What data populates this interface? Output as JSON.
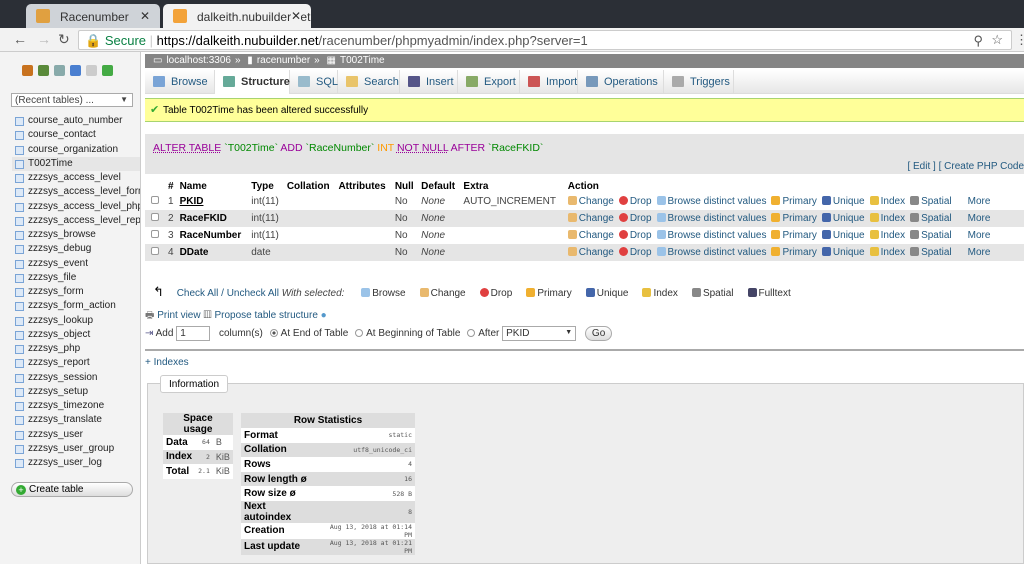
{
  "browser": {
    "tabs": [
      {
        "title": "Racenumber",
        "active": false
      },
      {
        "title": "dalkeith.nubuilder.net / lo",
        "active": true
      }
    ],
    "secure_label": "Secure",
    "url_host": "https://dalkeith.nubuilder.net",
    "url_path": "/racenumber/phpmyadmin/index.php?server=1"
  },
  "sidebar": {
    "nav_icons": [
      "home-icon",
      "logout-icon",
      "sql-query-icon",
      "docs-icon",
      "settings-icon",
      "reload-icon"
    ],
    "recent_tables": "(Recent tables) ...",
    "tables": [
      "course_auto_number",
      "course_contact",
      "course_organization",
      "T002Time",
      "zzzsys_access_level",
      "zzzsys_access_level_form",
      "zzzsys_access_level_php",
      "zzzsys_access_level_report",
      "zzzsys_browse",
      "zzzsys_debug",
      "zzzsys_event",
      "zzzsys_file",
      "zzzsys_form",
      "zzzsys_form_action",
      "zzzsys_lookup",
      "zzzsys_object",
      "zzzsys_php",
      "zzzsys_report",
      "zzzsys_session",
      "zzzsys_setup",
      "zzzsys_timezone",
      "zzzsys_translate",
      "zzzsys_user",
      "zzzsys_user_group",
      "zzzsys_user_log"
    ],
    "selected_table": "T002Time",
    "create_table": "Create table"
  },
  "breadcrumb": [
    "localhost:3306",
    "racenumber",
    "T002Time"
  ],
  "tabs": [
    {
      "label": "Browse",
      "color": "#7aa4d6"
    },
    {
      "label": "Structure",
      "color": "#6a9"
    },
    {
      "label": "SQL",
      "color": "#9bc"
    },
    {
      "label": "Search",
      "color": "#e9c46a"
    },
    {
      "label": "Insert",
      "color": "#558"
    },
    {
      "label": "Export",
      "color": "#8a6"
    },
    {
      "label": "Import",
      "color": "#c55"
    },
    {
      "label": "Operations",
      "color": "#79b"
    },
    {
      "label": "Triggers",
      "color": "#aaa"
    }
  ],
  "active_tab": "Structure",
  "message": "Table T002Time has been altered successfully",
  "sql": {
    "kw1": "ALTER TABLE",
    "t1": "`T002Time`",
    "kw2": "ADD",
    "t2": "`RaceNumber`",
    "type": "INT",
    "kw3": "NOT NULL",
    "kw4": "AFTER",
    "t3": "`RaceFKID`"
  },
  "sql_links": {
    "open": "[",
    "edit": "Edit",
    "mid": "] [",
    "php": "Create PHP Code"
  },
  "columns": [
    "#",
    "Name",
    "Type",
    "Collation",
    "Attributes",
    "Null",
    "Default",
    "Extra",
    "Action"
  ],
  "rows": [
    {
      "num": "1",
      "name": "PKID",
      "type": "int(11)",
      "collation": "",
      "attributes": "",
      "null": "No",
      "default": "None",
      "extra": "AUTO_INCREMENT",
      "primary_key": true
    },
    {
      "num": "2",
      "name": "RaceFKID",
      "type": "int(11)",
      "collation": "",
      "attributes": "",
      "null": "No",
      "default": "None",
      "extra": "",
      "primary_key": false
    },
    {
      "num": "3",
      "name": "RaceNumber",
      "type": "int(11)",
      "collation": "",
      "attributes": "",
      "null": "No",
      "default": "None",
      "extra": "",
      "primary_key": false
    },
    {
      "num": "4",
      "name": "DDate",
      "type": "date",
      "collation": "",
      "attributes": "",
      "null": "No",
      "default": "None",
      "extra": "",
      "primary_key": false
    }
  ],
  "row_actions": [
    {
      "label": "Change",
      "icon": "pencil-icon",
      "color": "#e9b96e"
    },
    {
      "label": "Drop",
      "icon": "drop-icon",
      "color": "#e04040"
    },
    {
      "label": "Browse distinct values",
      "icon": "browse-icon",
      "color": "#9bc3e8"
    },
    {
      "label": "Primary",
      "icon": "key-icon",
      "color": "#f0b030"
    },
    {
      "label": "Unique",
      "icon": "unique-icon",
      "color": "#4466aa"
    },
    {
      "label": "Index",
      "icon": "index-icon",
      "color": "#e8c040"
    },
    {
      "label": "Spatial",
      "icon": "spatial-icon",
      "color": "#888"
    },
    {
      "label": "More",
      "icon": "caret-down-icon",
      "color": "#000"
    }
  ],
  "with_selected": {
    "check_all": "Check All / Uncheck All",
    "label": "With selected:",
    "actions": [
      {
        "label": "Browse",
        "color": "#9bc3e8"
      },
      {
        "label": "Change",
        "color": "#e9b96e"
      },
      {
        "label": "Drop",
        "color": "#e04040"
      },
      {
        "label": "Primary",
        "color": "#f0b030"
      },
      {
        "label": "Unique",
        "color": "#4466aa"
      },
      {
        "label": "Index",
        "color": "#e8c040"
      },
      {
        "label": "Spatial",
        "color": "#888"
      },
      {
        "label": "Fulltext",
        "color": "#446"
      }
    ]
  },
  "print_view": "Print view",
  "propose": "Propose table structure",
  "add": {
    "label": "Add",
    "count": "1",
    "columns_label": "column(s)",
    "opt_end": "At End of Table",
    "opt_begin": "At Beginning of Table",
    "opt_after": "After",
    "after_value": "PKID",
    "selected": "end",
    "go": "Go"
  },
  "indexes": "+ Indexes",
  "information": "Information",
  "space_usage": {
    "title": "Space usage",
    "rows": [
      {
        "label": "Data",
        "value": "64",
        "unit": "B"
      },
      {
        "label": "Index",
        "value": "2",
        "unit": "KiB"
      },
      {
        "label": "Total",
        "value": "2.1",
        "unit": "KiB"
      }
    ]
  },
  "row_stats": {
    "title": "Row Statistics",
    "rows": [
      {
        "label": "Format",
        "value": "static"
      },
      {
        "label": "Collation",
        "value": "utf8_unicode_ci"
      },
      {
        "label": "Rows",
        "value": "4"
      },
      {
        "label": "Row length ø",
        "value": "16"
      },
      {
        "label": "Row size ø",
        "value": "528 B"
      },
      {
        "label": "Next autoindex",
        "value": "8"
      },
      {
        "label": "Creation",
        "value": "Aug 13, 2018 at 01:14 PM"
      },
      {
        "label": "Last update",
        "value": "Aug 13, 2018 at 01:21 PM"
      }
    ]
  }
}
